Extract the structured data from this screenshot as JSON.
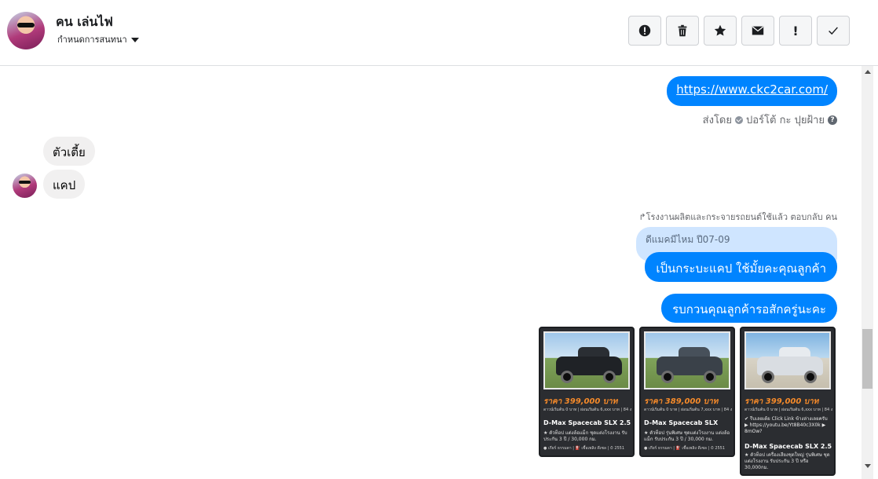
{
  "header": {
    "contact_name": "คน เล่นไฟ",
    "subtitle": "กำหนดการสนทนา",
    "actions": [
      {
        "icon": "alert-circle-icon"
      },
      {
        "icon": "trash-icon"
      },
      {
        "icon": "star-icon"
      },
      {
        "icon": "mail-icon"
      },
      {
        "icon": "exclamation-icon",
        "label": "!"
      },
      {
        "icon": "check-icon"
      }
    ]
  },
  "messages": {
    "link": "https://www.ckc2car.com/",
    "sent_by_prefix": "ส่งโดย",
    "sent_by_name": "ปอร์โต้ กะ ปุยฝ้าย",
    "help": "?",
    "incoming_1": "ตัวเตี้ย",
    "incoming_2": "แคป",
    "reply_note": "โรงงานผลิตและกระจายรถยนต์ใช้แล้ว ตอบกลับ คน",
    "quoted": "ดีแมคมีไหม ปี07-09",
    "reply": "เป็นกระบะแคป ใช้มั้ยคะคุณลูกค้า",
    "wait": "รบกวนคุณลูกค้ารอสักครู่นะคะ"
  },
  "cards": [
    {
      "price": "ราคา 399,000 บาท",
      "meta": "ดาวน์เริ่มต้น 0 บาท | ผ่อนเริ่มต้น 6,xxx บาท | 84 งวด",
      "model": "D-Max Spacecab SLX 2.5",
      "desc": "★ ตัวท็อป แต่งล้อแม็ก ชุดแต่งโรงงาน รับประกัน 3 ปี / 30,000 กม.",
      "foot": "● เกียร์ ธรรมดา | ⛽ เชื้อเพลิง ดีเซล | ⏱ 2551"
    },
    {
      "price": "ราคา 389,000 บาท",
      "meta": "ดาวน์เริ่มต้น 0 บาท | ผ่อนเริ่มต้น 7,xxx บาท | 84 งวด",
      "model": "D-Max Spacecab SLX",
      "desc": "★ ตัวท็อป รุ่นพิเศษ ชุดแต่งโรงงาน แต่งล้อแม็ก รับประกัน 3 ปี / 30,000 กม.",
      "foot": "● เกียร์ ธรรมดา | ⛽ เชื้อเพลิง ดีเซล | ⏱ 2551"
    },
    {
      "price": "ราคา 399,000 บาท",
      "meta": "ดาวน์เริ่มต้น 0 บาท | ผ่อนเริ่มต้น 6,xxx บาท | 84 งวด",
      "extra": "✔ รีบเลยเด้ย Click Link ข้างล่างเลยครับ ▶ https://youtu.be/Yt8B40c3X0k ▶ 8mOw?",
      "model": "D-Max Spacecab SLX 2.5",
      "desc": "★ ตัวท็อป เครื่องเสียงชุดใหญ่ รุ่นพิเศษ ชุดแต่งโรงงาน รับประกัน 3 ปี หรือ 30,000กม.",
      "foot": ""
    }
  ]
}
